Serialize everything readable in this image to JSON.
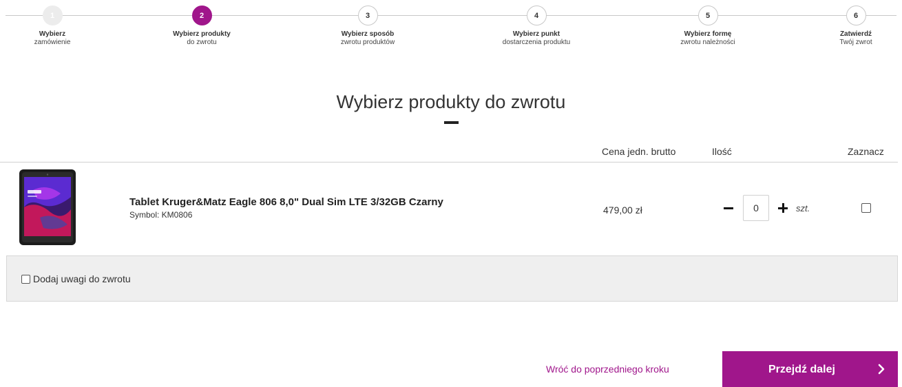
{
  "stepper": {
    "steps": [
      {
        "number": "1",
        "title": "Wybierz",
        "subtitle": "zamówienie",
        "state": "done"
      },
      {
        "number": "2",
        "title": "Wybierz produkty",
        "subtitle": "do zwrotu",
        "state": "active"
      },
      {
        "number": "3",
        "title": "Wybierz sposób",
        "subtitle": "zwrotu produktów",
        "state": "pending"
      },
      {
        "number": "4",
        "title": "Wybierz punkt",
        "subtitle": "dostarczenia produktu",
        "state": "pending"
      },
      {
        "number": "5",
        "title": "Wybierz formę",
        "subtitle": "zwrotu należności",
        "state": "pending"
      },
      {
        "number": "6",
        "title": "Zatwierdź",
        "subtitle": "Twój zwrot",
        "state": "pending"
      }
    ]
  },
  "main": {
    "title": "Wybierz produkty do zwrotu"
  },
  "table": {
    "headers": {
      "price": "Cena jedn. brutto",
      "quantity": "Ilość",
      "select": "Zaznacz"
    },
    "rows": [
      {
        "name": "Tablet Kruger&Matz Eagle 806 8,0\" Dual Sim LTE 3/32GB Czarny",
        "symbol": "Symbol: KM0806",
        "price": "479,00 zł",
        "quantity": "0",
        "unit": "szt.",
        "selected": false,
        "image_icon": "tablet-product-image"
      }
    ]
  },
  "notes": {
    "label": "Dodaj uwagi do zwrotu",
    "checked": false
  },
  "footer": {
    "back_label": "Wróć do poprzedniego kroku",
    "next_label": "Przejdź dalej",
    "next_icon": "chevron-right-icon"
  },
  "colors": {
    "accent": "#a0168b",
    "done_step": "#ececec",
    "notes_bg": "#efefef"
  }
}
